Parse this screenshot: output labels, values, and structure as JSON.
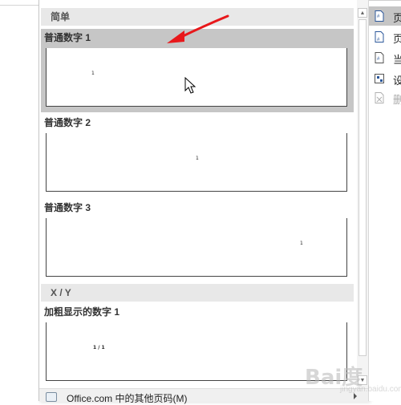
{
  "gallery": {
    "sections": [
      {
        "label": "简单"
      },
      {
        "label": "X / Y"
      }
    ],
    "items": [
      {
        "title": "普通数字 1",
        "page_number": "1",
        "alignment": "left",
        "selected": true
      },
      {
        "title": "普通数字 2",
        "page_number": "1",
        "alignment": "center",
        "selected": false
      },
      {
        "title": "普通数字 3",
        "page_number": "1",
        "alignment": "right",
        "selected": false
      },
      {
        "title": "加粗显示的数字 1",
        "page_number": "1 / 1",
        "alignment": "left",
        "selected": false
      }
    ],
    "footer": {
      "label": "Office.com 中的其他页码(M)",
      "icon": "globe-page-icon"
    }
  },
  "context_menu": {
    "items": [
      {
        "label": "页",
        "icon": "page-top-icon",
        "state": "hover"
      },
      {
        "label": "页",
        "icon": "page-bottom-icon",
        "state": "normal"
      },
      {
        "label": "当",
        "icon": "current-position-icon",
        "state": "normal"
      },
      {
        "label": "设",
        "icon": "format-page-number-icon",
        "state": "normal"
      },
      {
        "label": "删",
        "icon": "remove-page-number-icon",
        "state": "disabled"
      }
    ]
  },
  "watermark": {
    "text": "Bai度",
    "subtext": "jingyan.baidu.com"
  },
  "colors": {
    "selected_bg": "#c6c6c6",
    "section_header_bg": "#e8e8e8",
    "annotation_arrow": "#e8181b",
    "menu_icon": "#2b579a"
  }
}
